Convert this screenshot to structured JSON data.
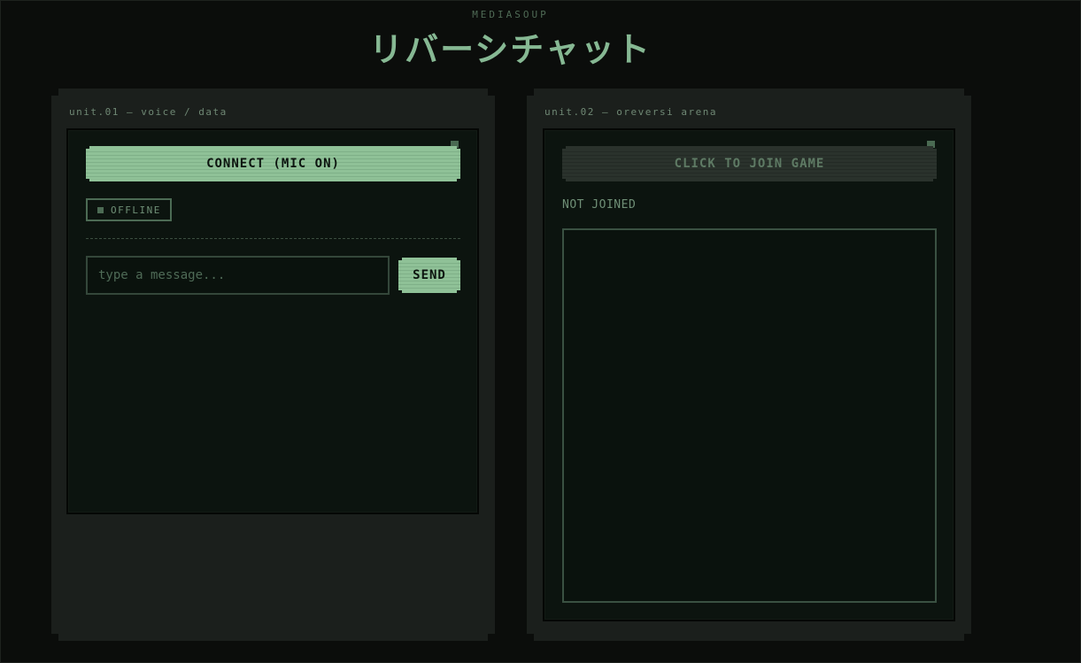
{
  "header": {
    "brand": "MEDIASOUP",
    "title": "リバーシチャット"
  },
  "unit1": {
    "label": "unit.01 — voice / data",
    "connect_button": "CONNECT (MIC ON)",
    "status": "OFFLINE",
    "message_placeholder": "type a message...",
    "message_value": "",
    "send_button": "SEND"
  },
  "unit2": {
    "label": "unit.02 — oreversi arena",
    "join_button": "CLICK TO JOIN GAME",
    "join_status": "NOT JOINED"
  },
  "colors": {
    "accent": "#86b893",
    "button_green": "#8fc197",
    "button_dim": "#2a322c",
    "panel": "#1b1f1c",
    "screen": "#0c140f",
    "background": "#0b0d0b"
  },
  "icons": {
    "status_indicator": "square-dot-icon",
    "screen_corner": "power-led-icon"
  }
}
